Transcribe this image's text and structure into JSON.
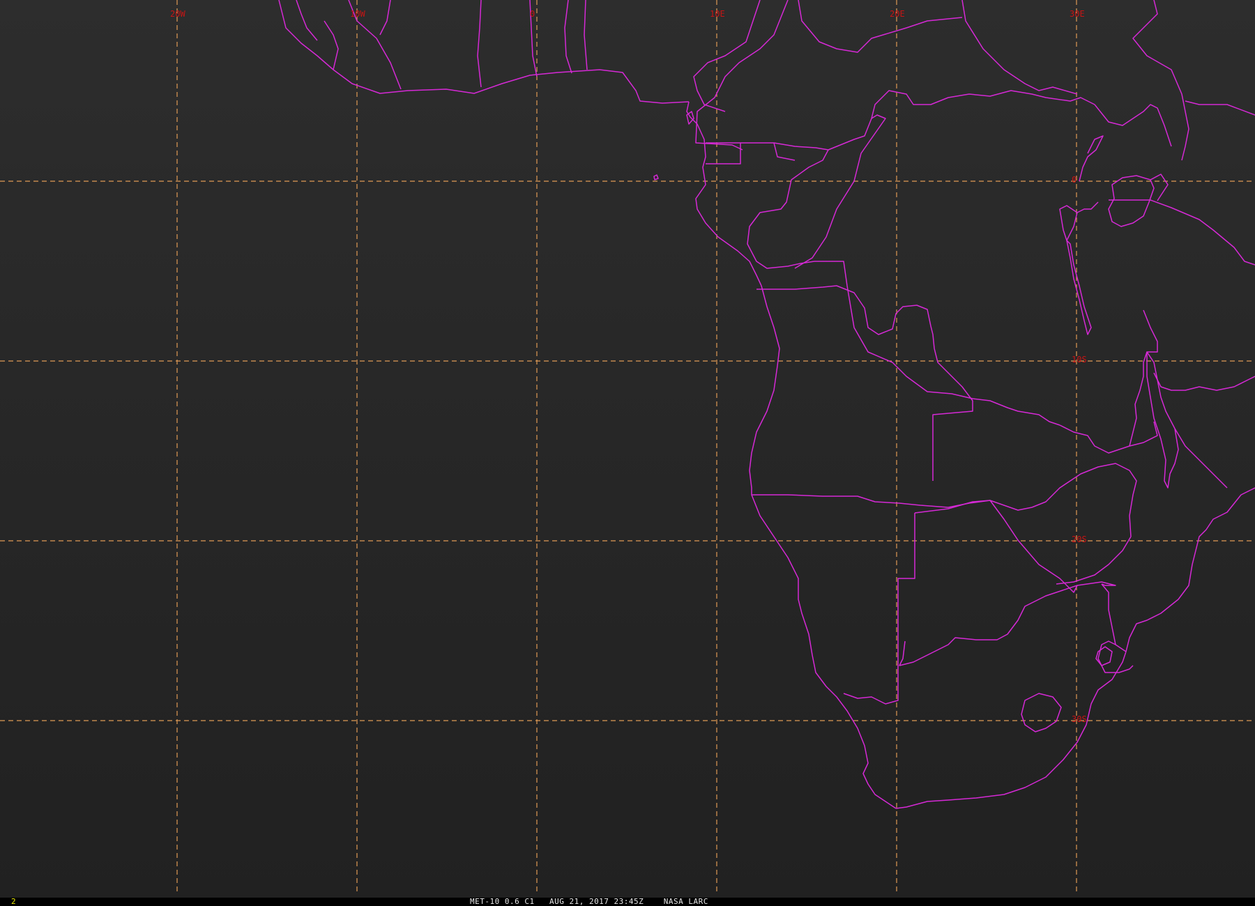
{
  "map": {
    "longitude_labels": [
      {
        "lon": -20,
        "text": "20W"
      },
      {
        "lon": -10,
        "text": "10W"
      },
      {
        "lon": 0,
        "text": "0"
      },
      {
        "lon": 10,
        "text": "10E"
      },
      {
        "lon": 20,
        "text": "20E"
      },
      {
        "lon": 30,
        "text": "30E"
      }
    ],
    "latitude_labels": [
      {
        "lat": 0,
        "text": "0"
      },
      {
        "lat": -10,
        "text": "10S"
      },
      {
        "lat": -20,
        "text": "20S"
      },
      {
        "lat": -30,
        "text": "30S"
      }
    ],
    "colors": {
      "grid": "#e09a55",
      "boundaries": "#d629d6",
      "labels": "#c81414",
      "background": "#262626"
    }
  },
  "status": {
    "frame": "2",
    "caption": "MET-10 0.6 C1   AUG 21, 2017 23:45Z    NASA LARC"
  }
}
